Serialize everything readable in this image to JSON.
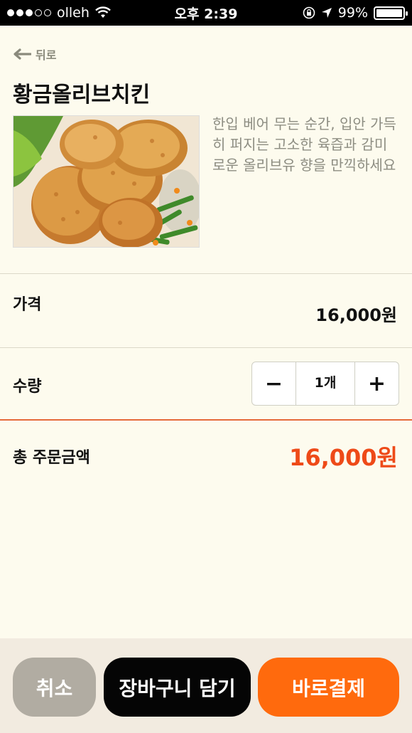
{
  "status_bar": {
    "carrier": "olleh",
    "time": "오후 2:39",
    "battery": "99%",
    "battery_level": 0.99
  },
  "nav": {
    "back_label": "뒤로"
  },
  "product": {
    "name": "황금올리브치킨",
    "description": "한입 베어 무는 순간, 입안 가득히 퍼지는 고소한 육즙과 감미로운 올리브유 향을 만끽하세요"
  },
  "price": {
    "label": "가격",
    "value": "16,000원"
  },
  "quantity": {
    "label": "수량",
    "minus": "−",
    "value": "1개",
    "plus": "+"
  },
  "total": {
    "label": "총 주문금액",
    "value": "16,000원"
  },
  "actions": {
    "cancel": "취소",
    "add_to_cart": "장바구니 담기",
    "buy_now": "바로결제"
  },
  "colors": {
    "background": "#fdfbee",
    "accent": "#ee4a18",
    "buy_button": "#ff6a0d",
    "cart_button": "#050505",
    "cancel_button": "#b1aca2"
  }
}
